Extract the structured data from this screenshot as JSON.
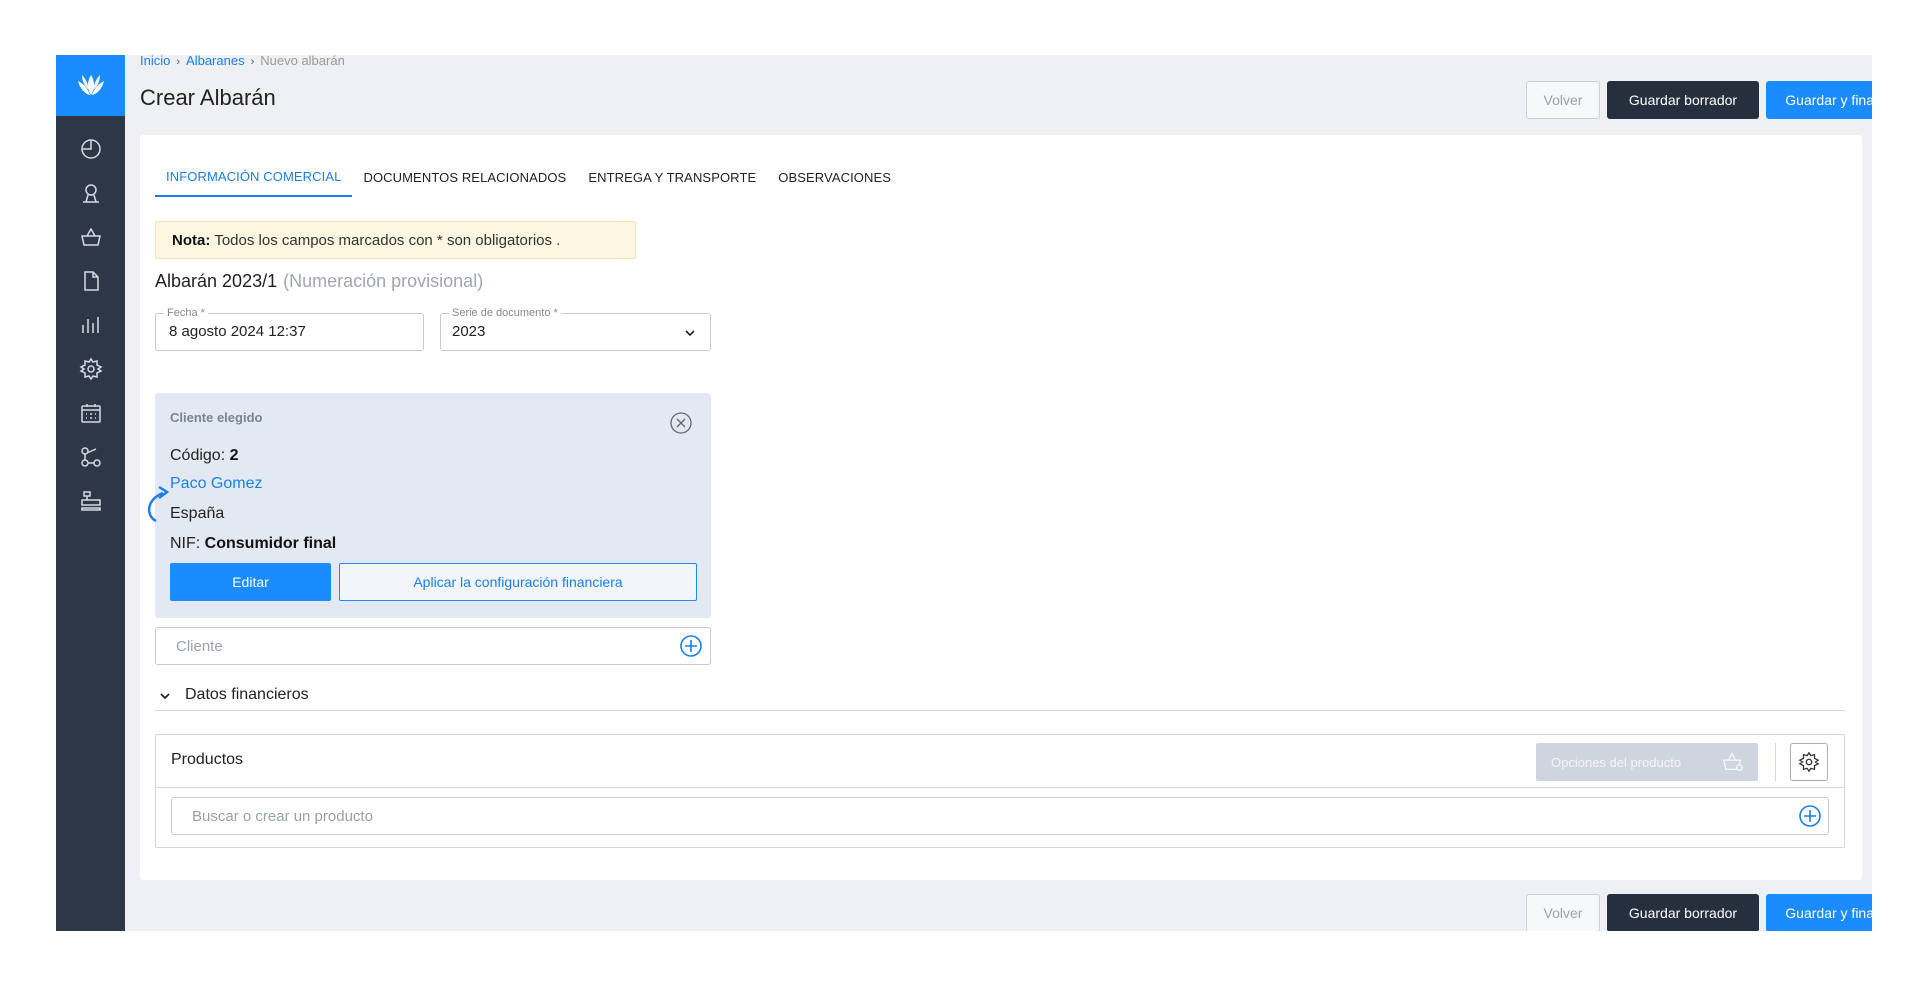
{
  "breadcrumb": {
    "home": "Inicio",
    "section": "Albaranes",
    "current": "Nuevo albarán"
  },
  "page_title": "Crear Albarán",
  "actions": {
    "back": "Volver",
    "save_draft": "Guardar borrador",
    "save_finalize": "Guardar y finalizar"
  },
  "tabs": [
    {
      "label": "INFORMACIÓN COMERCIAL",
      "active": true
    },
    {
      "label": "DOCUMENTOS RELACIONADOS",
      "active": false
    },
    {
      "label": "ENTREGA Y TRANSPORTE",
      "active": false
    },
    {
      "label": "OBSERVACIONES",
      "active": false
    }
  ],
  "note": {
    "bold": "Nota:",
    "text": "Todos los campos marcados con * son obligatorios ."
  },
  "document": {
    "title": "Albarán 2023/1",
    "provisional": "(Numeración provisional)"
  },
  "date_field": {
    "label": "Fecha *",
    "value": "8 agosto 2024 12:37"
  },
  "series_field": {
    "label": "Serie de documento *",
    "value": "2023"
  },
  "client": {
    "heading": "Cliente elegido",
    "code_label": "Código:",
    "code_value": "2",
    "name": "Paco Gomez",
    "country": "España",
    "nif_label": "NIF:",
    "nif_value": "Consumidor final",
    "edit_label": "Editar",
    "financial_label": "Aplicar la configuración financiera"
  },
  "client_input": {
    "placeholder": "Cliente"
  },
  "financial_section": {
    "label": "Datos financieros"
  },
  "products": {
    "title": "Productos",
    "options_label": "Opciones del producto",
    "search_placeholder": "Buscar o crear un producto"
  },
  "colors": {
    "accent": "#1a8cff",
    "sidebar": "#2d3748",
    "dark_button": "#262f3d",
    "note_bg": "#fdf6e1",
    "client_bg": "#e3e9f2"
  },
  "sidebar_icons": [
    "dashboard-icon",
    "user-icon",
    "basket-icon",
    "document-icon",
    "chart-icon",
    "gear-icon",
    "calendar-icon",
    "connections-icon",
    "register-icon"
  ]
}
